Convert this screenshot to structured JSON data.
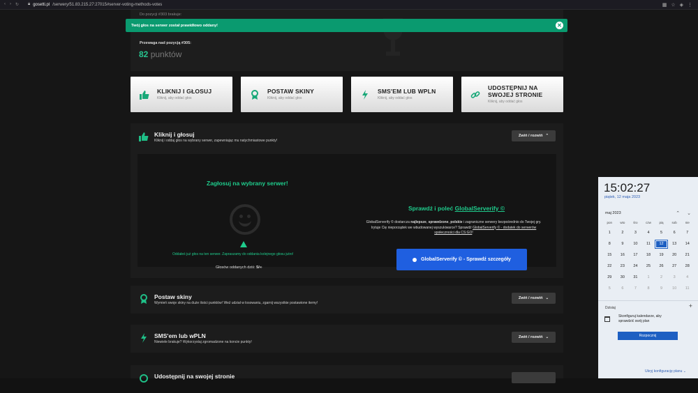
{
  "browser": {
    "url_host": "gosetti.pl",
    "url_path": "/serwery/51.83.215.27:27015#server-voting-methods-votes"
  },
  "stats": {
    "prev_label": "Do pozycji #303 brakuje:",
    "advantage_label": "Przewaga nad pozycją #305:",
    "points_value": "82",
    "points_unit": "punktów"
  },
  "notice": {
    "text": "Twój głos na serwer został prawidłowo oddany!"
  },
  "methods": [
    {
      "title": "KLIKNIJ I GŁOSUJ",
      "sub": "Kliknij, aby oddać głos",
      "icon": "thumbs-up-icon"
    },
    {
      "title": "POSTAW SKINY",
      "sub": "Kliknij, aby oddać głos",
      "icon": "award-icon"
    },
    {
      "title": "SMS'EM LUB WPLN",
      "sub": "Kliknij, aby oddać głos",
      "icon": "lightning-icon"
    },
    {
      "title": "UDOSTĘPNIJ NA SWOJEJ STRONIE",
      "sub": "Kliknij, aby oddać głos",
      "icon": "link-icon"
    }
  ],
  "sections": {
    "click_vote": {
      "title": "Kliknij i głosuj",
      "desc": "Kliknij i oddaj głos na wybrany serwer, zapewniając mu natychmiastowe punkty!",
      "toggle": "Zwiń / rozwiń"
    },
    "skins": {
      "title": "Postaw skiny",
      "desc": "Wymień swoje skiny na duże ilości punktów! Weź udział w losowaniu, zgarnij wszystkie postawione itemy!",
      "toggle": "Zwiń / rozwiń"
    },
    "sms": {
      "title": "SMS'em lub wPLN",
      "desc": "Niewiele brakuje? Wykorzystaj zgromadzone na koncie punkty!",
      "toggle": "Zwiń / rozwiń"
    },
    "share": {
      "title": "Udostępnij na swojej stronie"
    }
  },
  "vote": {
    "title": "Zagłosuj na wybrany serwer!",
    "voted_msg": "Oddałeś już głos na ten serwer. Zapraszamy do oddania kolejnego głosu jutro!",
    "count_label": "Głosów oddanych dziś:",
    "count_value": "5/∞"
  },
  "globalserverify": {
    "title_prefix": "Sprawdź i poleć",
    "title_link": "GlobalServerify ©",
    "desc_1": "GlobalServerify © dostarcza ",
    "desc_b1": "najlepsze",
    "desc_2": ", ",
    "desc_b2": "sprawdzone",
    "desc_3": ", ",
    "desc_b3": "polskie",
    "desc_4": " i zagraniczne serwery bezpośrednio do Twojej gry. Irytuje Cię nieporządek we wbudowanej wyszukiwarce? Sprawdź ",
    "desc_link": "GlobalServerify © - dodatek do serwerów społeczności dla CS:GO",
    "desc_5": "!",
    "button": "GlobalServerify © - Sprawdź szczegóły"
  },
  "clock": {
    "time": "15:02:27",
    "date": "piątek, 12 maja 2023",
    "month": "maj 2023",
    "weekdays": [
      "pon",
      "wto",
      "śro",
      "czw",
      "pią",
      "sob",
      "nie"
    ],
    "days": [
      "1",
      "2",
      "3",
      "4",
      "5",
      "6",
      "7",
      "8",
      "9",
      "10",
      "11",
      "12",
      "13",
      "14",
      "15",
      "16",
      "17",
      "18",
      "19",
      "20",
      "21",
      "22",
      "23",
      "24",
      "25",
      "26",
      "27",
      "28",
      "29",
      "30",
      "31",
      "1",
      "2",
      "3",
      "4",
      "5",
      "6",
      "7",
      "8",
      "9",
      "10",
      "11"
    ],
    "today_label": "Dzisiaj",
    "config_text": "Skonfiguruj kalendarze, aby sprawdzić swój plan",
    "start_button": "Rozpocznij",
    "hide_plan": "Ukryj konfigurację planu ⌄"
  }
}
